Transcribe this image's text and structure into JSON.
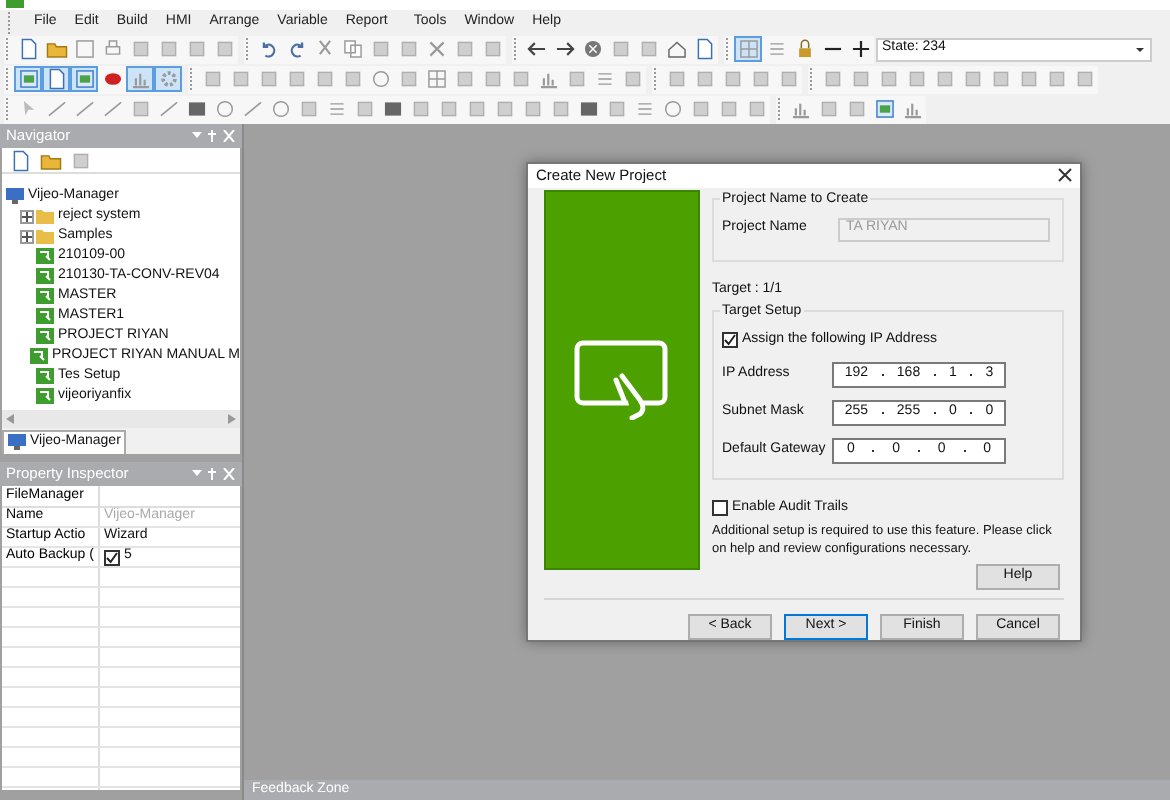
{
  "menu": [
    "File",
    "Edit",
    "Build",
    "HMI",
    "Arrange",
    "Variable",
    "Report",
    "Tools",
    "Window",
    "Help"
  ],
  "toolbar": {
    "state_combo": {
      "value": "State: 234"
    }
  },
  "navigator": {
    "title": "Navigator",
    "tree": [
      {
        "label": "Vijeo-Manager",
        "kind": "root",
        "children": [
          {
            "label": "reject system",
            "kind": "folder",
            "expanded": false
          },
          {
            "label": "Samples",
            "kind": "folder",
            "expanded": false
          },
          {
            "label": "210109-00",
            "kind": "project"
          },
          {
            "label": "210130-TA-CONV-REV04",
            "kind": "project"
          },
          {
            "label": "MASTER",
            "kind": "project"
          },
          {
            "label": "MASTER1",
            "kind": "project"
          },
          {
            "label": "PROJECT RIYAN",
            "kind": "project"
          },
          {
            "label": "PROJECT RIYAN MANUAL M",
            "kind": "project"
          },
          {
            "label": "Tes Setup",
            "kind": "project"
          },
          {
            "label": "vijeoriyanfix",
            "kind": "project"
          }
        ]
      }
    ],
    "tab": {
      "label": "Vijeo-Manager",
      "selected": true
    }
  },
  "property_inspector": {
    "title": "Property Inspector",
    "header": "FileManager",
    "rows": [
      {
        "name": "Name",
        "value": "Vijeo-Manager",
        "kind": "readonly"
      },
      {
        "name": "Startup Actio",
        "value": "Wizard",
        "kind": "text"
      },
      {
        "name": "Auto Backup (",
        "value": "5",
        "kind": "checkbox",
        "checked": true
      }
    ]
  },
  "dialog": {
    "title": "Create New Project",
    "name_group": {
      "title": "Project Name to Create",
      "label": "Project Name",
      "value": "TA RIYAN",
      "disabled": true
    },
    "target": "Target : 1/1",
    "target_group": {
      "title": "Target Setup",
      "assign": {
        "label": "Assign the following IP Address",
        "checked": true
      },
      "fields": [
        {
          "label": "IP Address",
          "octets": [
            "192",
            "168",
            "1",
            "3"
          ]
        },
        {
          "label": "Subnet Mask",
          "octets": [
            "255",
            "255",
            "0",
            "0"
          ]
        },
        {
          "label": "Default Gateway",
          "octets": [
            "0",
            "0",
            "0",
            "0"
          ]
        }
      ]
    },
    "audit": {
      "label": "Enable Audit Trails",
      "checked": false
    },
    "note": "Additional setup is required to use this feature. Please click on help and review configurations necessary.",
    "help": "Help",
    "buttons": [
      {
        "label": "< Back",
        "default": false
      },
      {
        "label": "Next >",
        "default": true
      },
      {
        "label": "Finish",
        "default": false
      },
      {
        "label": "Cancel",
        "default": false
      }
    ]
  },
  "feedback_zone": {
    "title": "Feedback Zone"
  }
}
